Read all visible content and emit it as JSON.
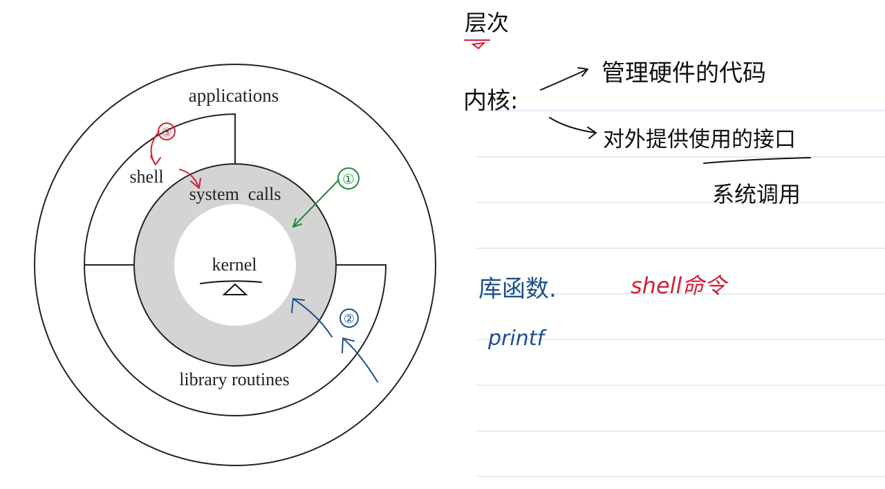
{
  "diagram": {
    "layers": {
      "outer": "applications",
      "shell": "shell",
      "calls": "system  calls",
      "library": "library routines",
      "core": "kernel"
    },
    "markers": {
      "green": "①",
      "blue": "②",
      "red": "③"
    }
  },
  "notes": {
    "heading": "层次",
    "kernel_label": "内核:",
    "kernel_point1": "管理硬件的代码",
    "kernel_point2": "对外提供使用的接口",
    "kernel_point3": "系统调用",
    "lib_label": "库函数.",
    "lib_example": "printf",
    "shell_cmd": "shell命令"
  },
  "colors": {
    "ink_black": "#111111",
    "ink_blue": "#1c4f8c",
    "ink_green": "#1e8a3a",
    "ink_red": "#d0213a",
    "ring_gray": "#d4d4d4",
    "rule_line": "#cfe2f3"
  }
}
